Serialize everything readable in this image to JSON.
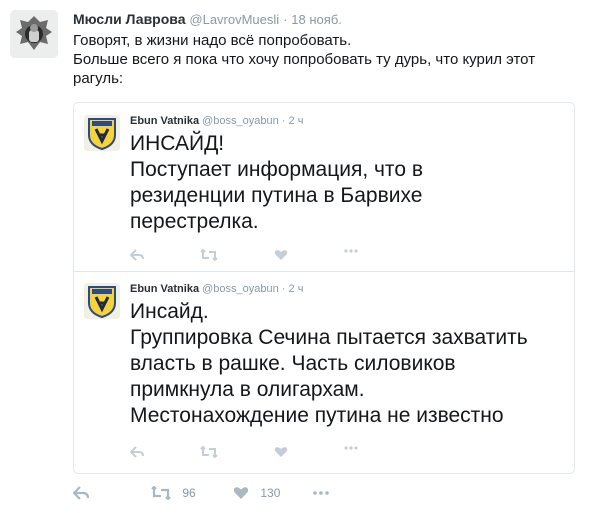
{
  "tweet": {
    "author_name": "Мюсли Лаврова",
    "author_handle": "@LavrovMuesli",
    "separator": "·",
    "timestamp": "18 нояб.",
    "text_lines": [
      "Говорят, в жизни надо всё попробовать.",
      "Больше всего я пока что хочу попробовать ту дурь, что курил этот",
      "рагуль:"
    ],
    "actions": {
      "reply_icon": "reply-icon",
      "retweet_icon": "retweet-icon",
      "retweet_count": "96",
      "like_icon": "heart-icon",
      "like_count": "130",
      "more_icon": "more-icon"
    }
  },
  "quoted": [
    {
      "author_name": "Ebun Vatnika",
      "author_handle": "@boss_oyabun",
      "separator": "·",
      "timestamp": "2 ч",
      "text_lines": [
        "ИНСАЙД!",
        "Поступает информация, что в",
        "резиденции путина в Барвихе",
        "перестрелка."
      ]
    },
    {
      "author_name": "Ebun Vatnika",
      "author_handle": "@boss_oyabun",
      "separator": "·",
      "timestamp": "2 ч",
      "text_lines": [
        "Инсайд.",
        "Группировка Сечина пытается захватить",
        "власть в рашке. Часть силовиков",
        "примкнула в олигархам.",
        "Местонахождение путина не известно"
      ]
    }
  ],
  "colors": {
    "text": "#14171a",
    "secondary": "#8899a6",
    "border": "#e1e8ed",
    "icon": "#aab8c2"
  }
}
